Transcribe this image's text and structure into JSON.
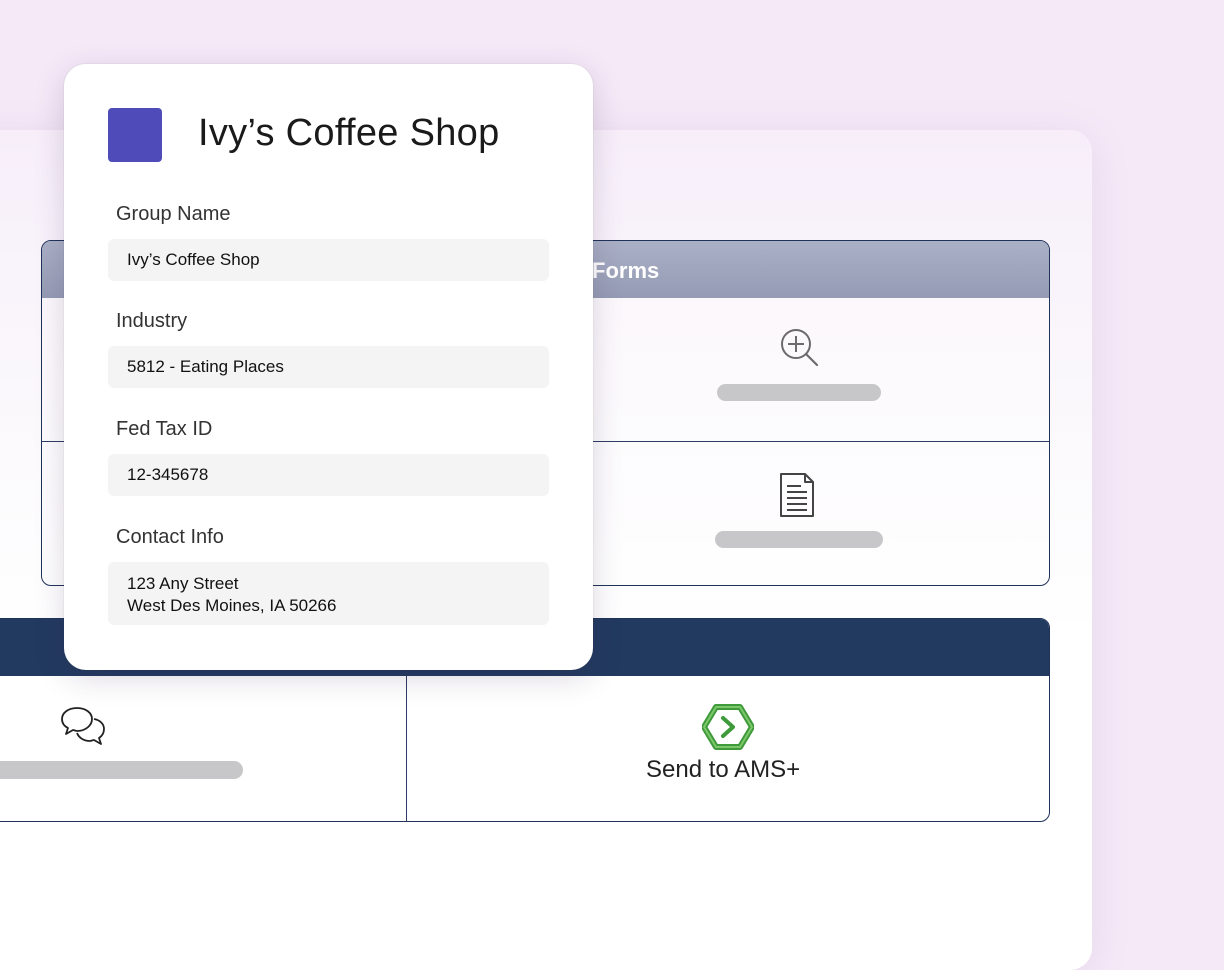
{
  "card": {
    "title": "Ivy’s Coffee Shop",
    "avatar_color": "#4f4bb8",
    "fields": [
      {
        "label": "Group Name",
        "value": "Ivy’s Coffee Shop"
      },
      {
        "label": "Industry",
        "value": "5812 - Eating Places"
      },
      {
        "label": "Fed Tax ID",
        "value": "12-345678"
      },
      {
        "label": "Contact Info",
        "value_line1": "123 Any Street",
        "value_line2": "West Des Moines, IA 50266"
      }
    ]
  },
  "forms_panel": {
    "title": "Forms",
    "header_color": "#9ca2ba",
    "rows": [
      {
        "icon": "zoom-in-icon"
      },
      {
        "icon": "document-icon"
      }
    ]
  },
  "action_panel": {
    "header_color": "#223a60",
    "items": [
      {
        "icon": "chat-bubbles-icon"
      },
      {
        "icon": "ams-plus-logo-icon",
        "label": "Send to AMS+",
        "icon_color": "#3f9a3b"
      }
    ]
  }
}
